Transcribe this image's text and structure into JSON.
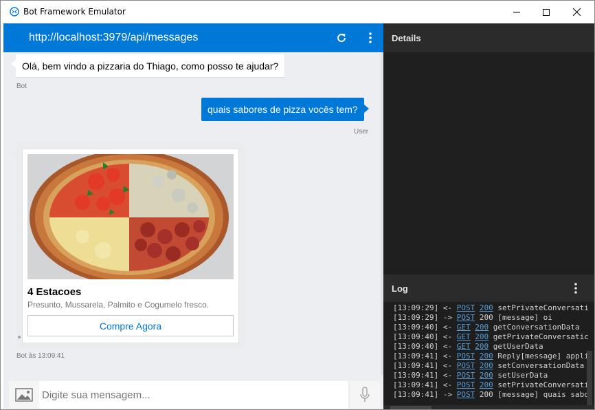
{
  "window": {
    "title": "Bot Framework Emulator"
  },
  "chat": {
    "endpoint_url": "http://localhost:3979/api/messages",
    "messages": [
      {
        "from": "bot",
        "text": "Olá, bem vindo a pizzaria do Thiago, como posso te ajudar?",
        "meta": "Bot"
      },
      {
        "from": "user",
        "text": "quais sabores de pizza vocês tem?",
        "meta": "User"
      }
    ],
    "card": {
      "title": "4 Estacoes",
      "subtitle": "Presunto, Mussarela, Palmito e Cogumelo fresco.",
      "button_label": "Compre Agora",
      "meta": "Bot às 13:09:41"
    },
    "composer": {
      "placeholder": "Digite sua mensagem..."
    }
  },
  "details": {
    "title": "Details"
  },
  "log": {
    "title": "Log",
    "entries": [
      {
        "time": "[13:09:29]",
        "dir": "<-",
        "verb": "POST",
        "code": "200",
        "text": "setPrivateConversati"
      },
      {
        "time": "[13:09:29]",
        "dir": "->",
        "verb": "POST",
        "code": "200",
        "text": "[message] oi"
      },
      {
        "time": "[13:09:40]",
        "dir": "<-",
        "verb": "GET",
        "code": "200",
        "text": "getConversationData"
      },
      {
        "time": "[13:09:40]",
        "dir": "<-",
        "verb": "GET",
        "code": "200",
        "text": "getPrivateConversatic"
      },
      {
        "time": "[13:09:40]",
        "dir": "<-",
        "verb": "GET",
        "code": "200",
        "text": "getUserData"
      },
      {
        "time": "[13:09:41]",
        "dir": "<-",
        "verb": "POST",
        "code": "200",
        "text": "Reply[message] appli"
      },
      {
        "time": "[13:09:41]",
        "dir": "<-",
        "verb": "POST",
        "code": "200",
        "text": "setConversationData"
      },
      {
        "time": "[13:09:41]",
        "dir": "<-",
        "verb": "POST",
        "code": "200",
        "text": "setUserData"
      },
      {
        "time": "[13:09:41]",
        "dir": "<-",
        "verb": "POST",
        "code": "200",
        "text": "setPrivateConversati"
      },
      {
        "time": "[13:09:41]",
        "dir": "->",
        "verb": "POST",
        "code": "200",
        "text": "[message] quais sabo"
      }
    ]
  },
  "colors": {
    "accent": "#0078d7",
    "log_link": "#569cd6",
    "dark_panel": "#1f1f1f"
  }
}
